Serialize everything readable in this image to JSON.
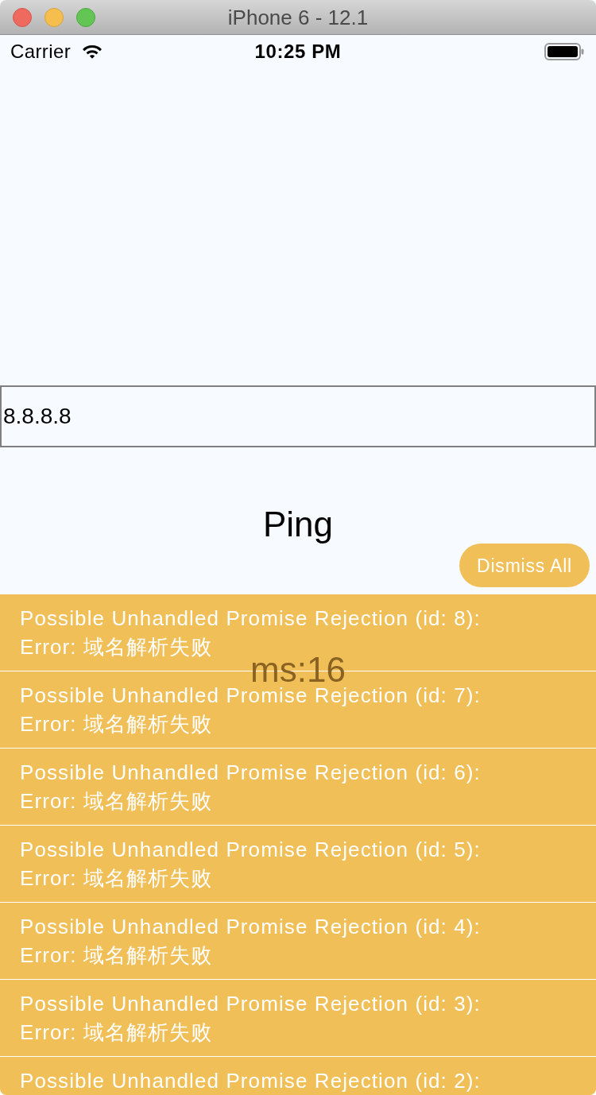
{
  "window": {
    "title": "iPhone 6 - 12.1"
  },
  "status_bar": {
    "carrier": "Carrier",
    "time": "10:25 PM"
  },
  "host_field": {
    "value": "8.8.8.8"
  },
  "ping_button": {
    "label": "Ping"
  },
  "result": {
    "text": "ms:16"
  },
  "dismiss_button": {
    "label": "Dismiss All"
  },
  "warnings": [
    {
      "title": "Possible Unhandled Promise Rejection (id: 8):",
      "message": "Error: 域名解析失败"
    },
    {
      "title": "Possible Unhandled Promise Rejection (id: 7):",
      "message": "Error: 域名解析失败"
    },
    {
      "title": "Possible Unhandled Promise Rejection (id: 6):",
      "message": "Error: 域名解析失败"
    },
    {
      "title": "Possible Unhandled Promise Rejection (id: 5):",
      "message": "Error: 域名解析失败"
    },
    {
      "title": "Possible Unhandled Promise Rejection (id: 4):",
      "message": "Error: 域名解析失败"
    },
    {
      "title": "Possible Unhandled Promise Rejection (id: 3):",
      "message": "Error: 域名解析失败"
    },
    {
      "title": "Possible Unhandled Promise Rejection (id: 2):"
    }
  ]
}
